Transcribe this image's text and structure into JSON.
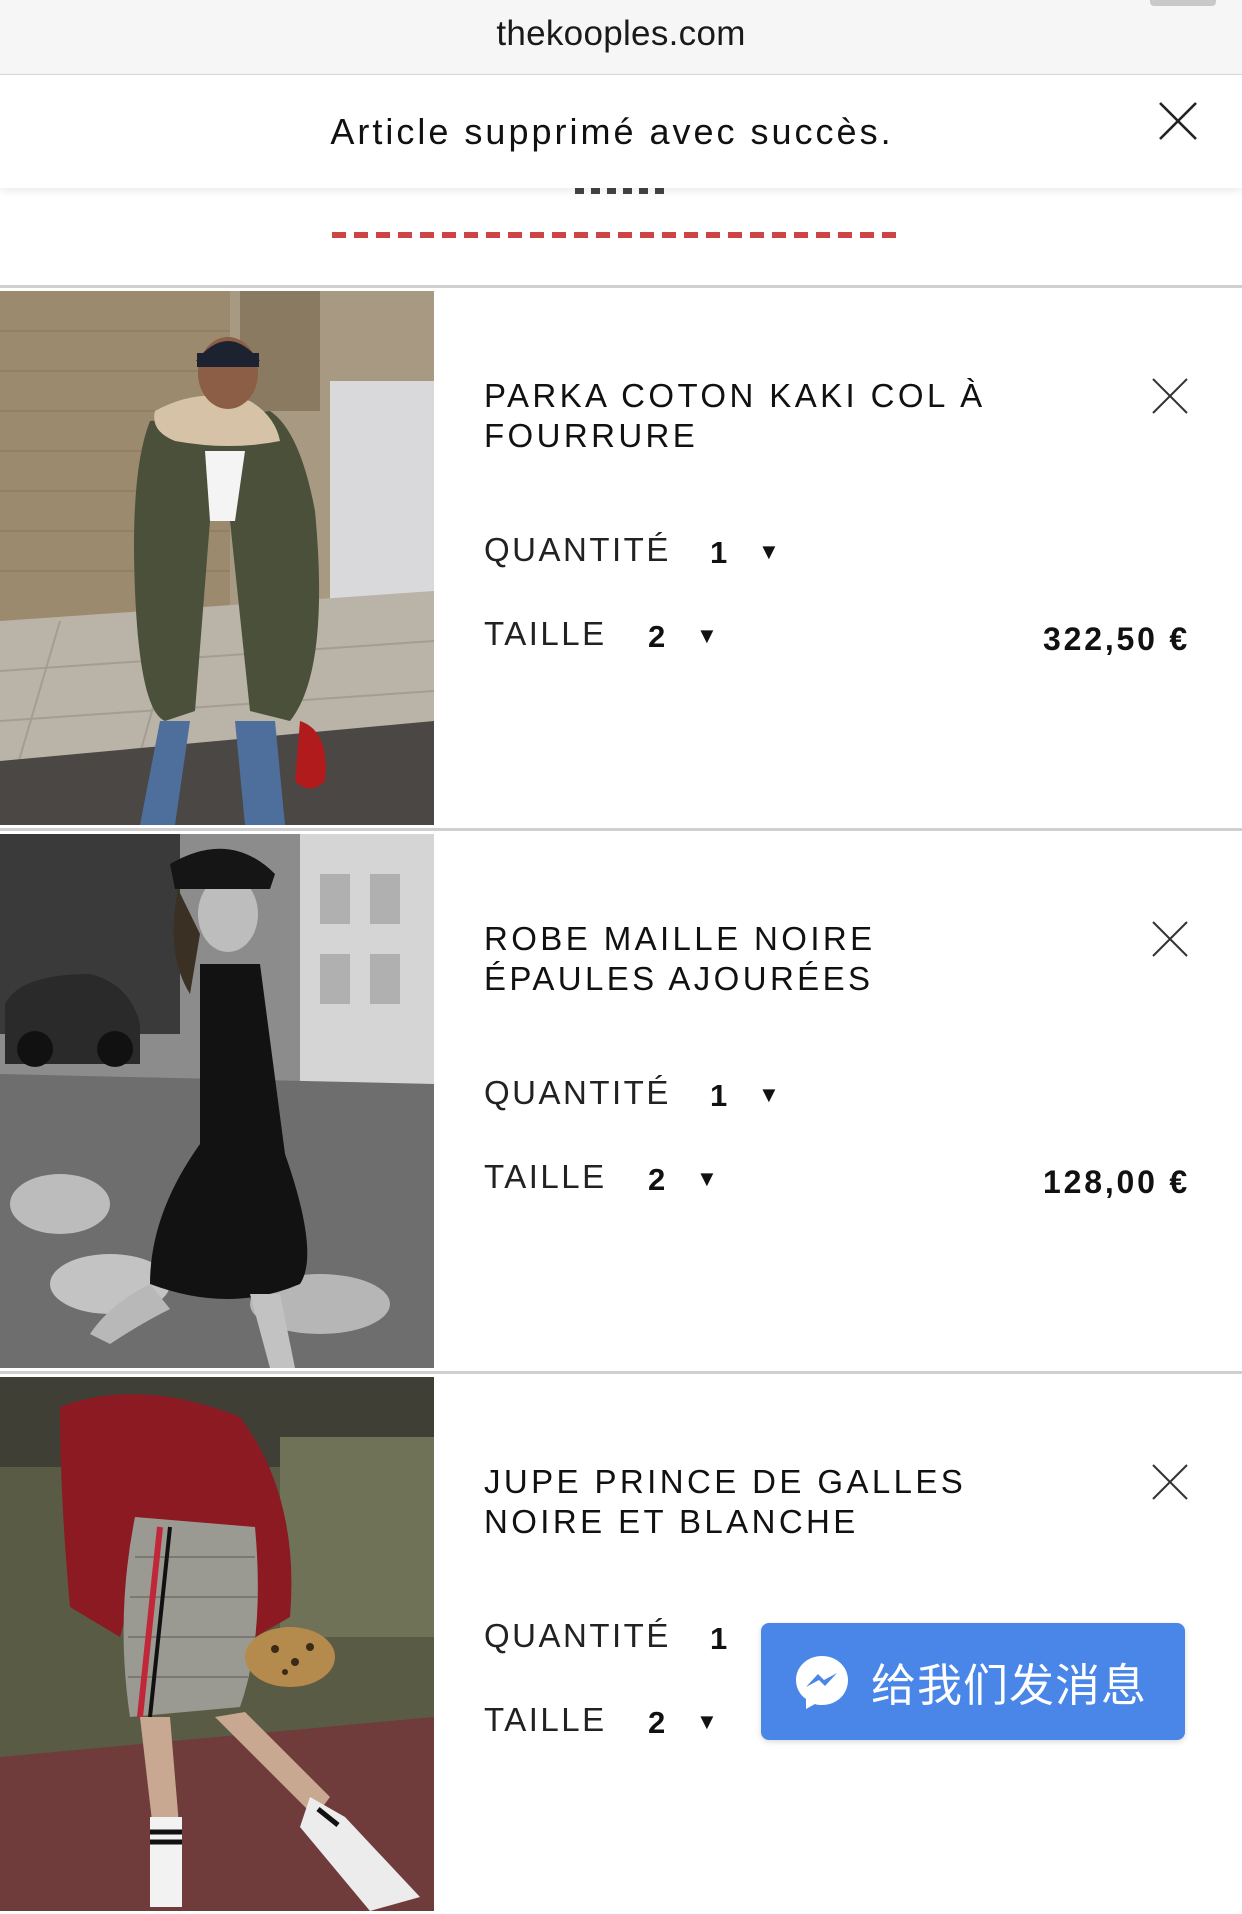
{
  "browser": {
    "url": "thekooples.com"
  },
  "notification": {
    "message": "Article supprimé avec succès."
  },
  "cart": {
    "items": [
      {
        "name": "PARKA COTON KAKI COL À FOURRURE",
        "qty_label": "QUANTITÉ",
        "qty": "1",
        "size_label": "TAILLE",
        "size": "2",
        "price": "322,50 €"
      },
      {
        "name": "ROBE MAILLE NOIRE ÉPAULES AJOURÉES",
        "qty_label": "QUANTITÉ",
        "qty": "1",
        "size_label": "TAILLE",
        "size": "2",
        "price": "128,00 €"
      },
      {
        "name": "JUPE PRINCE DE GALLES NOIRE ET BLANCHE",
        "qty_label": "QUANTITÉ",
        "qty": "1",
        "size_label": "TAILLE",
        "size": "2",
        "price": ""
      }
    ]
  },
  "messenger": {
    "label": "给我们发消息",
    "color": "#4a86e8",
    "icon": "messenger-icon"
  }
}
